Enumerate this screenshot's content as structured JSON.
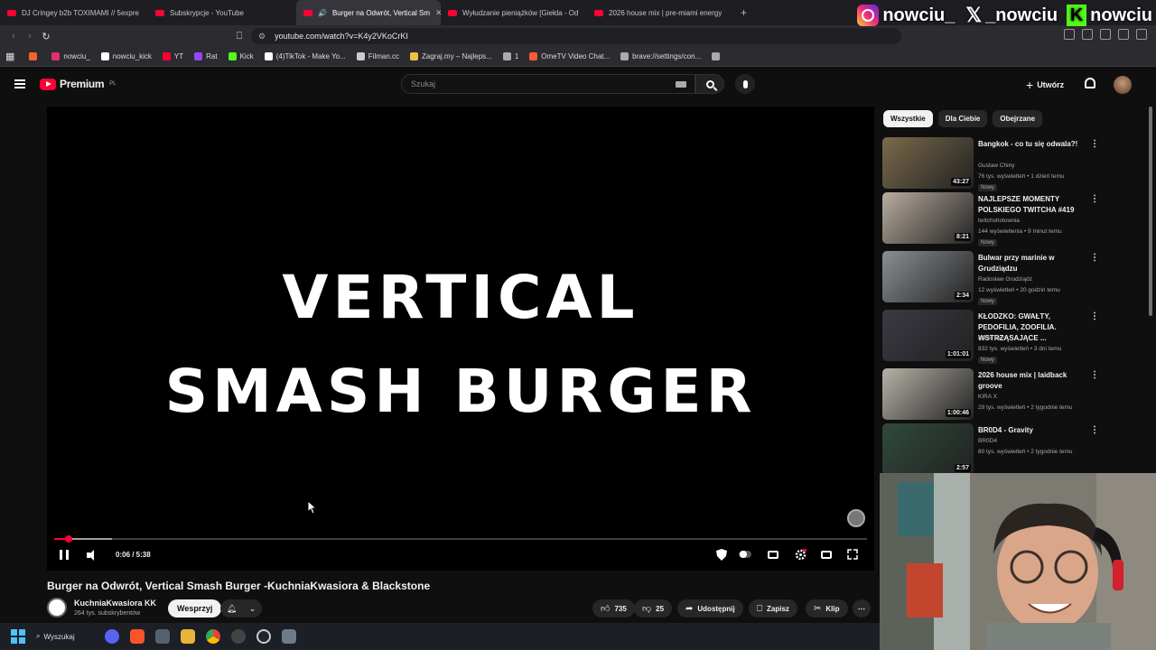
{
  "browser": {
    "tabs": [
      {
        "label": "DJ Cringey b2b TOXIMAMI // 5expre",
        "active": false
      },
      {
        "label": "Subskrypcje - YouTube",
        "active": false
      },
      {
        "label": "Burger na Odwrót, Vertical Sm",
        "active": true
      },
      {
        "label": "Wyłudzanie pieniążków [Giełda - Od",
        "active": false
      },
      {
        "label": "2026 house mix | pre-miami energy",
        "active": false
      }
    ],
    "new_tab": "+",
    "url": "youtube.com/watch?v=K4y2VKoCrKI",
    "bookmarks": [
      {
        "label": "",
        "icon": "rss-icon",
        "color": "#f4642a"
      },
      {
        "label": "nowciu_",
        "icon": "instagram-icon",
        "color": "#e1306c"
      },
      {
        "label": "nowciu_kick",
        "icon": "x-icon",
        "color": "#ffffff"
      },
      {
        "label": "YT",
        "icon": "youtube-icon",
        "color": "#ff0033"
      },
      {
        "label": "Rat",
        "icon": "twitch-icon",
        "color": "#9146ff"
      },
      {
        "label": "Kick",
        "icon": "kick-icon",
        "color": "#53fc18"
      },
      {
        "label": "(4)TikTok - Make Yo...",
        "icon": "tiktok-icon",
        "color": "#ffffff"
      },
      {
        "label": "Filman.cc",
        "icon": "filman-icon",
        "color": "#cccccc"
      },
      {
        "label": "Zagraj.my – Najleps...",
        "icon": "user-icon",
        "color": "#f0c040"
      },
      {
        "label": "1",
        "icon": "globe-icon",
        "color": "#aaaaaa"
      },
      {
        "label": "OmeTV Video Chat...",
        "icon": "ometv-icon",
        "color": "#ff5a36"
      },
      {
        "label": "brave://settings/con...",
        "icon": "globe-icon",
        "color": "#aaaaaa"
      },
      {
        "label": "",
        "icon": "globe-icon",
        "color": "#aaaaaa"
      }
    ]
  },
  "overlay": {
    "instagram": "nowciu_",
    "x": "_nowciu",
    "kick": "nowciu"
  },
  "header": {
    "logo": "Premium",
    "region": "PL",
    "search_placeholder": "Szukaj",
    "create_label": "Utwórz"
  },
  "player": {
    "title_line1": "VERTICAL",
    "title_line2": "SMASH BURGER",
    "time": "0:06 / 5:38",
    "progress": 0.018,
    "accent": "#ff0033"
  },
  "video": {
    "title": "Burger na Odwrót, Vertical Smash Burger -KuchniaKwasiora & Blackstone",
    "channel": "KuchniaKwasiora KK",
    "subscribers": "264 tys. subskrybentów",
    "support_label": "Wesprzyj",
    "likes": "735",
    "dislikes": "25",
    "share_label": "Udostępnij",
    "save_label": "Zapisz",
    "clip_label": "Klip",
    "more": "⋯"
  },
  "sidebar": {
    "chips": [
      {
        "label": "Wszystkie",
        "active": true
      },
      {
        "label": "Dla Ciebie",
        "active": false
      },
      {
        "label": "Obejrzane",
        "active": false
      }
    ],
    "items": [
      {
        "title": "Bangkok - co tu się odwala?!",
        "channel": "Gustaw Chiny",
        "meta": "76 tys. wyświetleń • 1 dzień temu",
        "badge": "Nowy",
        "duration": "43:27",
        "thumb": "#7a6a4a"
      },
      {
        "title": "NAJLEPSZE MOMENTY POLSKIEGO TWITCHA #419",
        "channel": "twitchshotownia",
        "meta": "144 wyświetlenia • 9 minut temu",
        "badge": "Nowy",
        "duration": "8:21",
        "thumb": "#b8aca0"
      },
      {
        "title": "Bulwar przy marinie w Grudziądzu",
        "channel": "Radosław Grudziądz",
        "meta": "12 wyświetleń • 20 godzin temu",
        "badge": "Nowy",
        "duration": "2:34",
        "thumb": "#8a8f94"
      },
      {
        "title": "KŁODZKO: GWAŁTY, PEDOFILIA, ZOOFILIA. WSTRZĄSAJĄCE ...",
        "channel": "Kanał Zero",
        "meta": "832 tys. wyświetleń • 3 dni temu",
        "badge": "Nowy",
        "duration": "1:01:01",
        "thumb": "#3a3a44"
      },
      {
        "title": "2026 house mix | laidback groove",
        "channel": "KIRA X",
        "meta": "29 tys. wyświetleń • 2 tygodnie temu",
        "badge": "",
        "duration": "1:00:46",
        "thumb": "#b7b2a8"
      },
      {
        "title": "BR0D4 - Gravity",
        "channel": "BR0D4",
        "meta": "80 tys. wyświetleń • 2 tygodnie temu",
        "badge": "",
        "duration": "2:57",
        "thumb": "#2f4a3a"
      }
    ]
  },
  "taskbar": {
    "search_label": "Wyszukaj"
  }
}
